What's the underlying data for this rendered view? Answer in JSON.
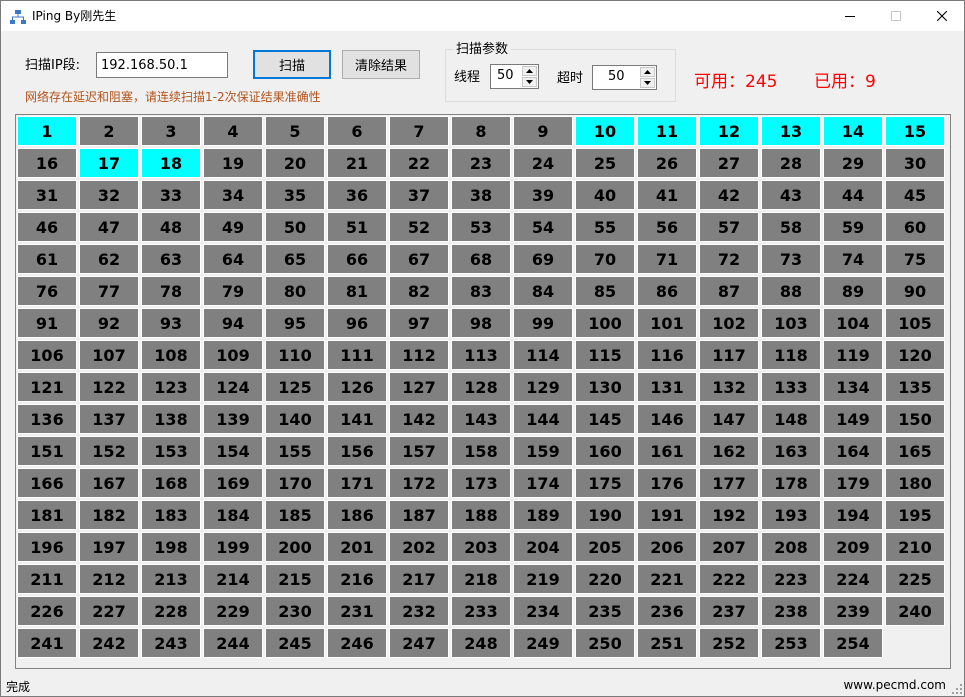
{
  "window": {
    "title": "IPing By刚先生",
    "icon": "network-icon"
  },
  "toolbar": {
    "ip_label": "扫描IP段:",
    "ip_value": "192.168.50.1",
    "scan_label": "扫描",
    "clear_label": "清除结果",
    "warning": "网络存在延迟和阻塞，请连续扫描1-2次保证结果准确性"
  },
  "params": {
    "group_title": "扫描参数",
    "threads_label": "线程",
    "threads_value": "50",
    "timeout_label": "超时",
    "timeout_value": "50"
  },
  "stats": {
    "available_text": "可用：245",
    "used_text": "已用：9",
    "color": "#ff0000"
  },
  "grid": {
    "count": 254,
    "columns": 15,
    "used": [
      1,
      10,
      11,
      12,
      13,
      14,
      15,
      17,
      18
    ],
    "used_color": "#00ffff",
    "free_color": "#808080"
  },
  "status": {
    "left": "完成",
    "right": "www.pecmd.com"
  }
}
